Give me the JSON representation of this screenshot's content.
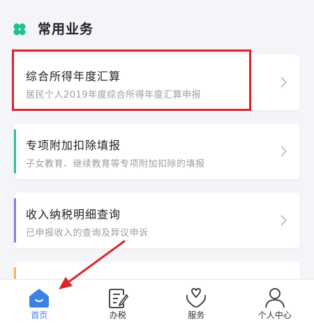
{
  "section": {
    "title": "常用业务",
    "icon": "clover-icon",
    "icon_color": "#1fc28a"
  },
  "cards": [
    {
      "title": "综合所得年度汇算",
      "subtitle": "居民个人2019年度综合所得年度汇算申报",
      "accent": "",
      "highlighted": true
    },
    {
      "title": "专项附加扣除填报",
      "subtitle": "子女教育、继续教育等专项附加扣除的填报",
      "accent": "#34c28b",
      "highlighted": false
    },
    {
      "title": "收入纳税明细查询",
      "subtitle": "已申报收入的查询及异议申诉",
      "accent": "#8b7be0",
      "highlighted": false
    },
    {
      "title": "",
      "subtitle": "",
      "accent": "#f2b45a",
      "highlighted": false
    }
  ],
  "bottom_nav": [
    {
      "label": "首页",
      "icon": "home-icon",
      "active": true
    },
    {
      "label": "办税",
      "icon": "document-edit-icon",
      "active": false
    },
    {
      "label": "服务",
      "icon": "heart-hand-icon",
      "active": false
    },
    {
      "label": "个人中心",
      "icon": "person-icon",
      "active": false
    }
  ],
  "colors": {
    "accent_blue": "#3b82e8",
    "annotation_red": "#d9262c",
    "background": "#f4f5f9"
  }
}
